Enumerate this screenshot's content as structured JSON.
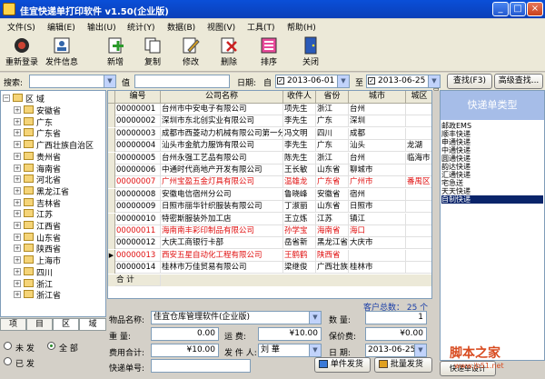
{
  "window": {
    "title": "佳宜快递单打印软件 v1.50(企业版)"
  },
  "menu": [
    "文件(S)",
    "编辑(E)",
    "输出(U)",
    "统计(Y)",
    "数据(B)",
    "视图(V)",
    "工具(T)",
    "帮助(H)"
  ],
  "toolbar": [
    "重新登录",
    "发件信息",
    "新增",
    "复制",
    "修改",
    "删除",
    "排序",
    "关闭"
  ],
  "filter": {
    "search_label": "搜索:",
    "value_label": "值",
    "date_label": "日期:",
    "from_label": "自",
    "from_date": "2013-06-01",
    "to_label": "至",
    "to_date": "2013-06-25",
    "search_button": "查找(F3)",
    "advanced_button": "高级查找..."
  },
  "region_tree": {
    "root": "区  域",
    "items": [
      "安徽省",
      "广东",
      "广东省",
      "广西壮族自治区",
      "贵州省",
      "海南省",
      "河北省",
      "黑龙江省",
      "吉林省",
      "江苏",
      "江西省",
      "山东省",
      "陕西省",
      "上海市",
      "四川",
      "浙江",
      "浙江省"
    ],
    "tabs": [
      "项",
      "目",
      "区",
      "域"
    ]
  },
  "grid": {
    "columns": [
      "编号",
      "公司名称",
      "收件人",
      "省份",
      "城市",
      "城区"
    ],
    "rows": [
      [
        "00000001",
        "台州市中安电子有限公司",
        "项先生",
        "浙江",
        "台州",
        ""
      ],
      [
        "00000002",
        "深圳市东北创实业有限公司",
        "李先生",
        "广东",
        "深圳",
        ""
      ],
      [
        "00000003",
        "成都市西菱动力机械有限公司第一分公司",
        "冯文明",
        "四川",
        "成都",
        ""
      ],
      [
        "00000004",
        "汕头市金航力服饰有限公司",
        "李先生",
        "广东",
        "汕头",
        "龙湖"
      ],
      [
        "00000005",
        "台州永强工艺品有限公司",
        "陈先生",
        "浙江",
        "台州",
        "临海市"
      ],
      [
        "00000006",
        "中通时代商地产开发有限公司",
        "王长敏",
        "山东省",
        "聊城市",
        ""
      ],
      [
        "00000007",
        "广州宝盈五金灯具有限公司",
        "温雄龙",
        "广东省",
        "广州市",
        "番禺区"
      ],
      [
        "00000008",
        "安徽电信宿州分公司",
        "鲁晓峰",
        "安徽省",
        "宿州",
        ""
      ],
      [
        "00000009",
        "日照市丽华针织服装有限公司",
        "丁淑丽",
        "山东省",
        "日照市",
        ""
      ],
      [
        "00000010",
        "特密斯服装外加工店",
        "王立炼",
        "江苏",
        "镇江",
        ""
      ],
      [
        "00000011",
        "海南南丰彩印制品有限公司",
        "孙学宝",
        "海南省",
        "海口",
        ""
      ],
      [
        "00000012",
        "大庆工商银行卡部",
        "岳省新",
        "黑龙江省",
        "大庆市",
        ""
      ],
      [
        "00000013",
        "西安五星自动化工程有限公司",
        "王鹤鹤",
        "陕西省",
        "",
        ""
      ],
      [
        "00000014",
        "桂林市万佳贸易有限公司",
        "梁继俊",
        "广西壮族",
        "桂林市",
        ""
      ]
    ],
    "red_rows": [
      6,
      10,
      12
    ],
    "summary_label": "合  计",
    "customer_total": "客户总数：  25  个"
  },
  "express_panel": {
    "title": "快递单类型",
    "items": [
      "邮政EMS",
      "顺丰快递",
      "申通快递",
      "中通快递",
      "圆通快递",
      "韵达快递",
      "汇通快递",
      "宅急送",
      "天天快递",
      "自制快递"
    ],
    "selected": 9
  },
  "form": {
    "product_label": "物品名称:",
    "product_value": "佳宜仓库管理软件(企业版)",
    "qty_label": "数  量:",
    "qty_value": "1",
    "weight_label": "重  量:",
    "weight_value": "0.00",
    "freight_label": "运  费:",
    "freight_value": "¥10.00",
    "insure_label": "保价费:",
    "insure_value": "¥0.00",
    "cost_label": "费用合计:",
    "cost_value": "¥10.00",
    "sender_label": "发 件 人:",
    "sender_value": "刘  華",
    "date_label": "日  期:",
    "date_value": "2013-06-25",
    "tracking_label": "快递单号:",
    "tracking_value": "",
    "single_button": "单件发货",
    "batch_button": "批量发货",
    "design_button": "快递单设计"
  },
  "status_radio": {
    "unsent": "未  发",
    "all": "全  部",
    "sent": "已  发"
  },
  "watermark": {
    "brand": "脚本之家",
    "url": "www.jb51.net"
  }
}
